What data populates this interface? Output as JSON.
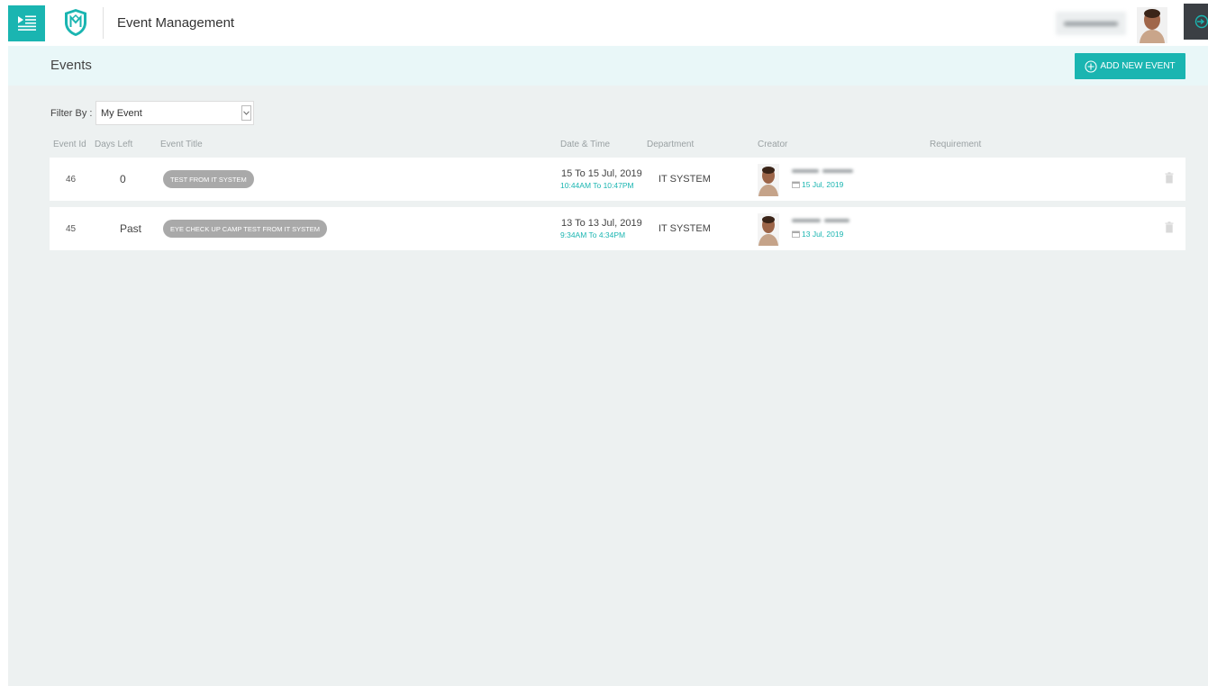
{
  "app": {
    "title": "Event Management"
  },
  "page": {
    "title": "Events",
    "add_button_label": "ADD NEW EVENT"
  },
  "filter": {
    "label": "Filter By :",
    "value": "My Event"
  },
  "table": {
    "headers": [
      "Event Id",
      "Days Left",
      "Event Title",
      "Date & Time",
      "Department",
      "Creator",
      "Requirement"
    ],
    "rows": [
      {
        "id": "46",
        "days_left": "0",
        "title": "TEST FROM IT SYSTEM",
        "date": "15 To 15 Jul, 2019",
        "time": "10:44AM To 10:47PM",
        "department": "IT SYSTEM",
        "created_on": "15 Jul, 2019"
      },
      {
        "id": "45",
        "days_left": "Past",
        "title": "EYE CHECK UP CAMP TEST FROM IT SYSTEM",
        "date": "13 To 13 Jul, 2019",
        "time": "9:34AM To 4:34PM",
        "department": "IT SYSTEM",
        "created_on": "13 Jul, 2019"
      }
    ]
  },
  "colors": {
    "accent": "#1ab5b1",
    "page_header_bg": "#e9f7f8",
    "content_bg": "#edf1f1",
    "pill_bg": "#a9a9a9"
  },
  "icons": {
    "menu": "menu-list-icon",
    "logo": "shield-logo-icon",
    "add": "plus-circle-icon",
    "logout": "logout-icon",
    "select": "chevron-down-icon",
    "calendar": "calendar-icon",
    "delete": "trash-icon"
  }
}
